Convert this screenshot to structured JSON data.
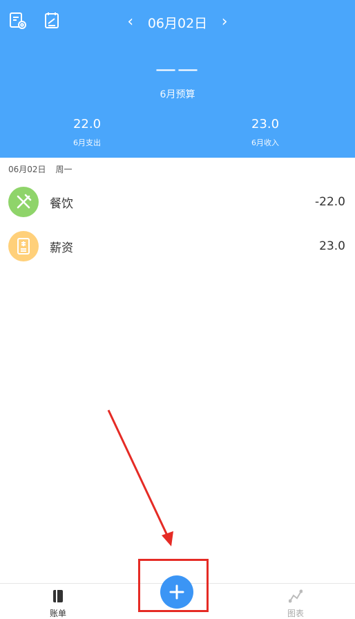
{
  "header": {
    "date": "06月02日",
    "prev_arrow": "‹",
    "next_arrow": "›",
    "budget_value": "——",
    "budget_label": "6月预算",
    "expense_value": "22.0",
    "expense_label": "6月支出",
    "income_value": "23.0",
    "income_label": "6月收入",
    "left_icons": [
      "settings-document-icon",
      "edit-note-icon"
    ],
    "bg_color": "#4aa6fb"
  },
  "day": {
    "date": "06月02日",
    "weekday": "周一"
  },
  "transactions": [
    {
      "category": "餐饮",
      "amount": "-22.0",
      "icon": "fork-knife-icon",
      "icon_color": "#8fd46a"
    },
    {
      "category": "薪资",
      "amount": "23.0",
      "icon": "payslip-icon",
      "icon_color": "#ffd07a"
    }
  ],
  "bottom_nav": {
    "bills_label": "账单",
    "charts_label": "图表",
    "add_icon": "plus-icon",
    "accent_color": "#3b95f5"
  },
  "annotation": {
    "color": "#e52b25"
  }
}
